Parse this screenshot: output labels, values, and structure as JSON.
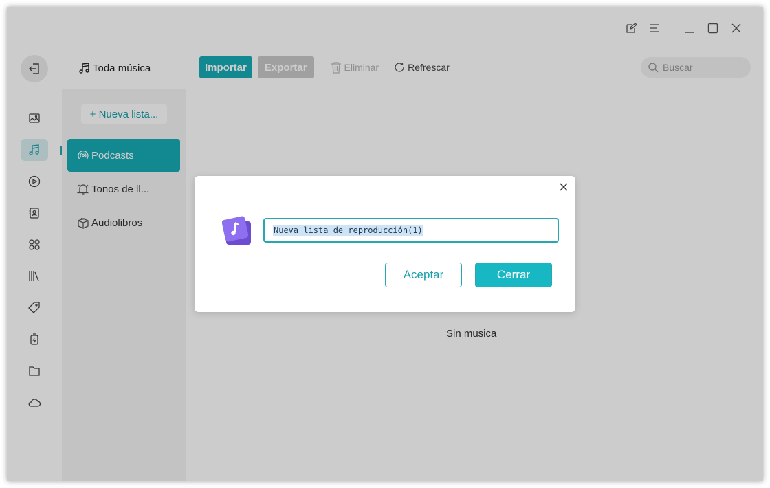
{
  "toolbar": {
    "import_label": "Importar",
    "export_label": "Exportar",
    "delete_label": "Eliminar",
    "refresh_label": "Refrescar",
    "search_placeholder": "Buscar"
  },
  "sidebar": {
    "header": "Toda música",
    "new_list": "+ Nueva lista...",
    "items": [
      {
        "label": "Podcasts",
        "icon": "podcast-icon",
        "active": true
      },
      {
        "label": "Tonos de ll...",
        "icon": "bell-icon",
        "active": false
      },
      {
        "label": "Audiolibros",
        "icon": "book-box-icon",
        "active": false
      }
    ]
  },
  "rail": {
    "icons": [
      "back-icon",
      "image-icon",
      "music-icon",
      "video-icon",
      "contacts-icon",
      "apps-icon",
      "books-icon",
      "tag-icon",
      "ringtone-icon",
      "folder-icon",
      "cloud-icon"
    ],
    "active": "music-icon"
  },
  "main": {
    "empty_text": "Sin musica"
  },
  "dialog": {
    "input_value": "Nueva lista de reproducción(1)",
    "accept_label": "Aceptar",
    "close_label": "Cerrar"
  },
  "colors": {
    "accent": "#17aab6",
    "overlay": "rgba(0,0,0,0.2)"
  }
}
